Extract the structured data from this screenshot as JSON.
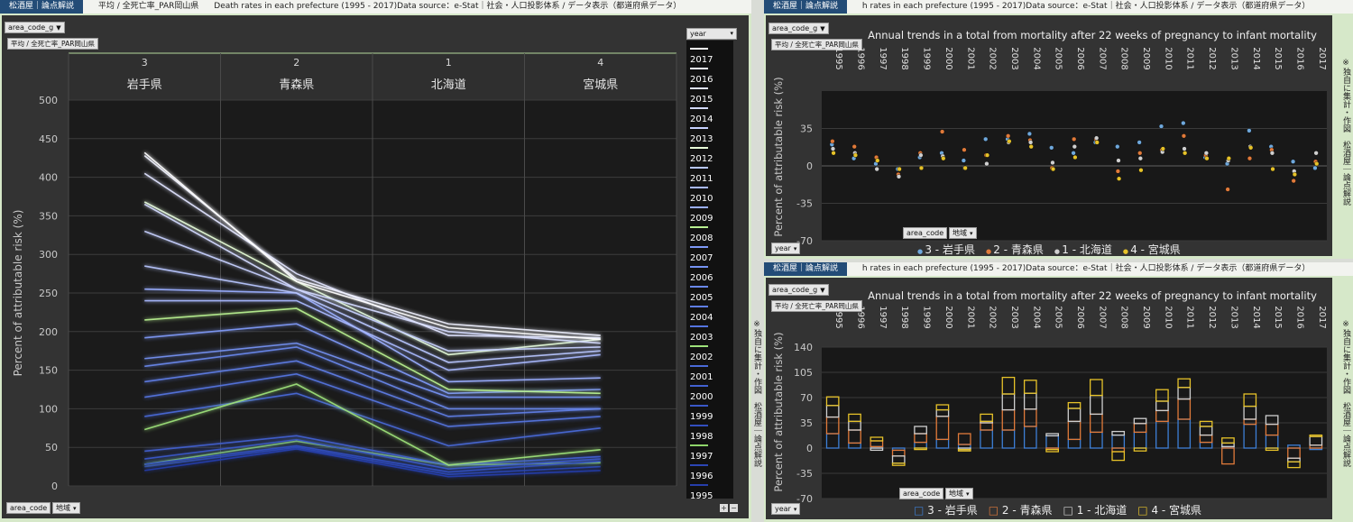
{
  "header_left": {
    "brand": "松酒屋｜論点解説",
    "t1": "平均 / 全死亡率_PAR岡山県",
    "t2": "Death rates in each prefecture (1995 - 2017)Data source：e-Stat｜社会・人口投影体系 / データ表示（都道府県データ）"
  },
  "header_right": {
    "brand": "松酒屋｜論点解説",
    "t1": "h rates in each prefecture (1995 - 2017)Data source：e-Stat｜社会・人口投影体系 / データ表示（都道府県データ）"
  },
  "filters": {
    "area_code_g": "area_code_g",
    "avg_label": "平均 / 全死亡率_PAR岡山県",
    "year": "year",
    "area_code": "area_code",
    "region": "地域",
    "plus": "+",
    "minus": "−"
  },
  "side_note": "※独自に集計・作図　松酒屋｜論点解説",
  "colors": {
    "accent": "#1e4a78",
    "panel": "#d6e8c9",
    "bg": "#333333",
    "iwate": "#6fa8dc",
    "aomori": "#e07a3a",
    "hokkaido": "#cfcfcf",
    "miyagi": "#e6c229"
  },
  "chart_data": [
    {
      "type": "line",
      "ylabel": "Percent of attributable risk (%)",
      "ylim": [
        0,
        500
      ],
      "yticks": [
        0,
        50,
        100,
        150,
        200,
        250,
        300,
        350,
        400,
        450,
        500
      ],
      "categories": [
        {
          "code": "3",
          "name": "岩手県"
        },
        {
          "code": "2",
          "name": "青森県"
        },
        {
          "code": "1",
          "name": "北海道"
        },
        {
          "code": "4",
          "name": "宮城県"
        }
      ],
      "legend_title": "year",
      "series": [
        {
          "name": "2017",
          "color": "#ffffff",
          "values": [
            432,
            265,
            205,
            190
          ]
        },
        {
          "name": "2016",
          "color": "#eef0ff",
          "values": [
            428,
            268,
            210,
            195
          ]
        },
        {
          "name": "2015",
          "color": "#dfe3ff",
          "values": [
            405,
            275,
            195,
            192
          ]
        },
        {
          "name": "2014",
          "color": "#d3daff",
          "values": [
            365,
            255,
            200,
            185
          ]
        },
        {
          "name": "2013",
          "color": "#c7d1ff",
          "values": [
            330,
            255,
            175,
            180
          ]
        },
        {
          "name": "2012",
          "color": "#e8ffd8",
          "values": [
            368,
            265,
            170,
            190
          ]
        },
        {
          "name": "2011",
          "color": "#b8c6ff",
          "values": [
            285,
            250,
            160,
            175
          ]
        },
        {
          "name": "2010",
          "color": "#a9b9ff",
          "values": [
            240,
            240,
            150,
            170
          ]
        },
        {
          "name": "2009",
          "color": "#9aaeff",
          "values": [
            255,
            250,
            135,
            140
          ]
        },
        {
          "name": "2008",
          "color": "#b8f090",
          "values": [
            215,
            230,
            125,
            120
          ]
        },
        {
          "name": "2007",
          "color": "#7f99f7",
          "values": [
            192,
            210,
            120,
            125
          ]
        },
        {
          "name": "2006",
          "color": "#7592f2",
          "values": [
            165,
            185,
            115,
            115
          ]
        },
        {
          "name": "2005",
          "color": "#6a88ec",
          "values": [
            155,
            180,
            100,
            100
          ]
        },
        {
          "name": "2004",
          "color": "#5f7ee6",
          "values": [
            135,
            162,
            90,
            100
          ]
        },
        {
          "name": "2003",
          "color": "#5474e0",
          "values": [
            115,
            145,
            77,
            90
          ]
        },
        {
          "name": "2002",
          "color": "#9ee27a",
          "values": [
            73,
            132,
            27,
            47
          ]
        },
        {
          "name": "2001",
          "color": "#4a6ad8",
          "values": [
            90,
            120,
            52,
            75
          ]
        },
        {
          "name": "2000",
          "color": "#4261d0",
          "values": [
            45,
            65,
            27,
            38
          ]
        },
        {
          "name": "1999",
          "color": "#3a58c8",
          "values": [
            35,
            60,
            22,
            35
          ]
        },
        {
          "name": "1998",
          "color": "#334fbf",
          "values": [
            28,
            52,
            18,
            32
          ]
        },
        {
          "name": "1997",
          "color": "#8fd66a",
          "values": [
            28,
            58,
            27,
            30
          ]
        },
        {
          "name": "1996",
          "color": "#2c46b5",
          "values": [
            25,
            50,
            15,
            25
          ]
        },
        {
          "name": "1995",
          "color": "#263eab",
          "values": [
            20,
            48,
            12,
            20
          ]
        }
      ]
    },
    {
      "type": "scatter",
      "title": "Annual trends in a total from mortality after 22 weeks of pregnancy to infant mortality",
      "ylabel": "Percent of attributable risk (%)",
      "ylim": [
        -70,
        70
      ],
      "yticks": [
        -70,
        -35,
        0,
        35
      ],
      "x": [
        "1995",
        "1996",
        "1997",
        "1998",
        "1999",
        "2000",
        "2001",
        "2002",
        "2003",
        "2004",
        "2005",
        "2006",
        "2007",
        "2008",
        "2009",
        "2010",
        "2011",
        "2012",
        "2013",
        "2014",
        "2015",
        "2016",
        "2017"
      ],
      "series": [
        {
          "name": "3 - 岩手県",
          "color": "#6fa8dc",
          "values": [
            20,
            7,
            2,
            -3,
            8,
            12,
            5,
            25,
            25,
            30,
            17,
            12,
            22,
            18,
            22,
            37,
            40,
            8,
            2,
            33,
            18,
            4,
            -2
          ]
        },
        {
          "name": "2 - 青森県",
          "color": "#e07a3a",
          "values": [
            23,
            18,
            8,
            -8,
            12,
            32,
            15,
            10,
            28,
            24,
            -2,
            25,
            25,
            -5,
            12,
            15,
            28,
            10,
            -22,
            7,
            15,
            -14,
            4
          ]
        },
        {
          "name": "1 - 北海道",
          "color": "#cfcfcf",
          "values": [
            16,
            12,
            -3,
            -10,
            10,
            9,
            -2,
            2,
            22,
            22,
            3,
            18,
            26,
            5,
            7,
            13,
            16,
            12,
            5,
            18,
            12,
            -5,
            12
          ]
        },
        {
          "name": "4 - 宮城県",
          "color": "#e6c229",
          "values": [
            12,
            10,
            5,
            -3,
            -2,
            7,
            -2,
            10,
            23,
            18,
            -3,
            8,
            22,
            -12,
            -4,
            16,
            12,
            7,
            7,
            17,
            -3,
            -8,
            2
          ]
        }
      ],
      "legend": [
        "3 - 岩手県",
        "2 - 青森県",
        "1 - 北海道",
        "4 - 宮城県"
      ]
    },
    {
      "type": "bar",
      "title": "Annual trends in a total from mortality after 22 weeks of pregnancy to infant mortality",
      "ylabel": "Percent of attributable risk (%)",
      "ylim": [
        -70,
        140
      ],
      "yticks": [
        -70,
        -35,
        0,
        35,
        70,
        105,
        140
      ],
      "stacked": true,
      "x": [
        "1995",
        "1996",
        "1997",
        "1998",
        "1999",
        "2000",
        "2001",
        "2002",
        "2003",
        "2004",
        "2005",
        "2006",
        "2007",
        "2008",
        "2009",
        "2010",
        "2011",
        "2012",
        "2013",
        "2014",
        "2015",
        "2016",
        "2017"
      ],
      "series": [
        {
          "name": "3 - 岩手県",
          "color": "#3d7fd6",
          "values": [
            20,
            7,
            2,
            -3,
            8,
            12,
            5,
            25,
            25,
            30,
            17,
            12,
            22,
            18,
            22,
            37,
            40,
            8,
            2,
            33,
            18,
            4,
            -2
          ]
        },
        {
          "name": "2 - 青森県",
          "color": "#e07a3a",
          "values": [
            23,
            18,
            8,
            -8,
            12,
            32,
            15,
            10,
            28,
            24,
            -2,
            25,
            25,
            -5,
            12,
            15,
            28,
            10,
            -22,
            7,
            15,
            -14,
            4
          ]
        },
        {
          "name": "1 - 北海道",
          "color": "#cfcfcf",
          "values": [
            16,
            12,
            -3,
            -10,
            10,
            9,
            -2,
            2,
            22,
            22,
            3,
            18,
            26,
            5,
            7,
            13,
            16,
            12,
            5,
            18,
            12,
            -5,
            12
          ]
        },
        {
          "name": "4 - 宮城県",
          "color": "#e6c229",
          "values": [
            12,
            10,
            5,
            -3,
            -2,
            7,
            -2,
            10,
            23,
            18,
            -3,
            8,
            22,
            -12,
            -4,
            16,
            12,
            7,
            7,
            17,
            -3,
            -8,
            2
          ]
        }
      ],
      "legend": [
        "3 - 岩手県",
        "2 - 青森県",
        "1 - 北海道",
        "4 - 宮城県"
      ]
    }
  ]
}
